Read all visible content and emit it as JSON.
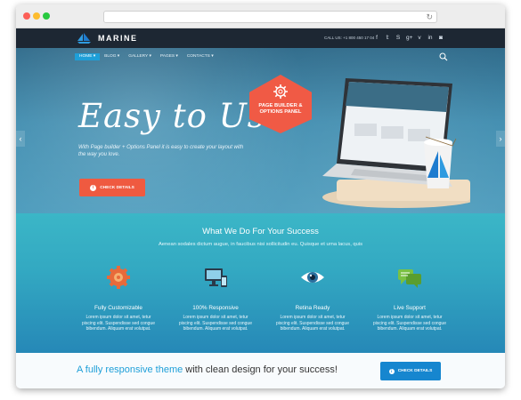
{
  "browser": {
    "reload_icon": "reload-icon"
  },
  "site": {
    "brand": "MARINE",
    "call_us": "CALL US: +1 800 450 17 04",
    "social_icons": [
      "facebook-icon",
      "twitter-icon",
      "skype-icon",
      "google-plus-icon",
      "vimeo-icon",
      "linkedin-icon",
      "instagram-icon"
    ],
    "social_glyphs": [
      "f",
      "𝕥",
      "S",
      "g+",
      "v",
      "in",
      "◙"
    ],
    "nav": [
      {
        "label": "HOME ▾"
      },
      {
        "label": "BLOG ▾"
      },
      {
        "label": "GALLERY ▾"
      },
      {
        "label": "PAGES ▾"
      },
      {
        "label": "CONTACTS ▾"
      }
    ],
    "hero": {
      "headline": "Easy to Use",
      "description": "With Page builder + Options Panel it is easy to create your layout with the way you love.",
      "cta_label": "CHECK DETAILS",
      "badge": "PAGE BUILDER & OPTIONS PANEL"
    },
    "section": {
      "title": "What We Do For Your Success",
      "subtitle": "Aenean sodales dictum augue, in faucibus nisi sollicitudin eu. Quisque et urna lacus, quis",
      "features": [
        {
          "title": "Fully Customizable",
          "text": "Lorem ipsum dolor sit amet, tetur piscing elit. Suspendisse sed congue bibendum. Aliquam erat volutpat."
        },
        {
          "title": "100% Responsive",
          "text": "Lorem ipsum dolor sit amet, tetur piscing elit. Suspendisse sed congue bibendum. Aliquam erat volutpat."
        },
        {
          "title": "Retina Ready",
          "text": "Lorem ipsum dolor sit amet, tetur piscing elit. Suspendisse sed congue bibendum. Aliquam erat volutpat."
        },
        {
          "title": "Live Support",
          "text": "Lorem ipsum dolor sit amet, tetur piscing elit. Suspendisse sed congue bibendum. Aliquam erat volutpat."
        }
      ]
    },
    "banner": {
      "highlight": "A fully responsive theme",
      "rest": " with clean design for your success!",
      "button_label": "CHECK DETAILS"
    }
  },
  "colors": {
    "accent_blue": "#1e9fd8",
    "cta_red": "#ef5a40",
    "topbar": "#1d2733"
  }
}
